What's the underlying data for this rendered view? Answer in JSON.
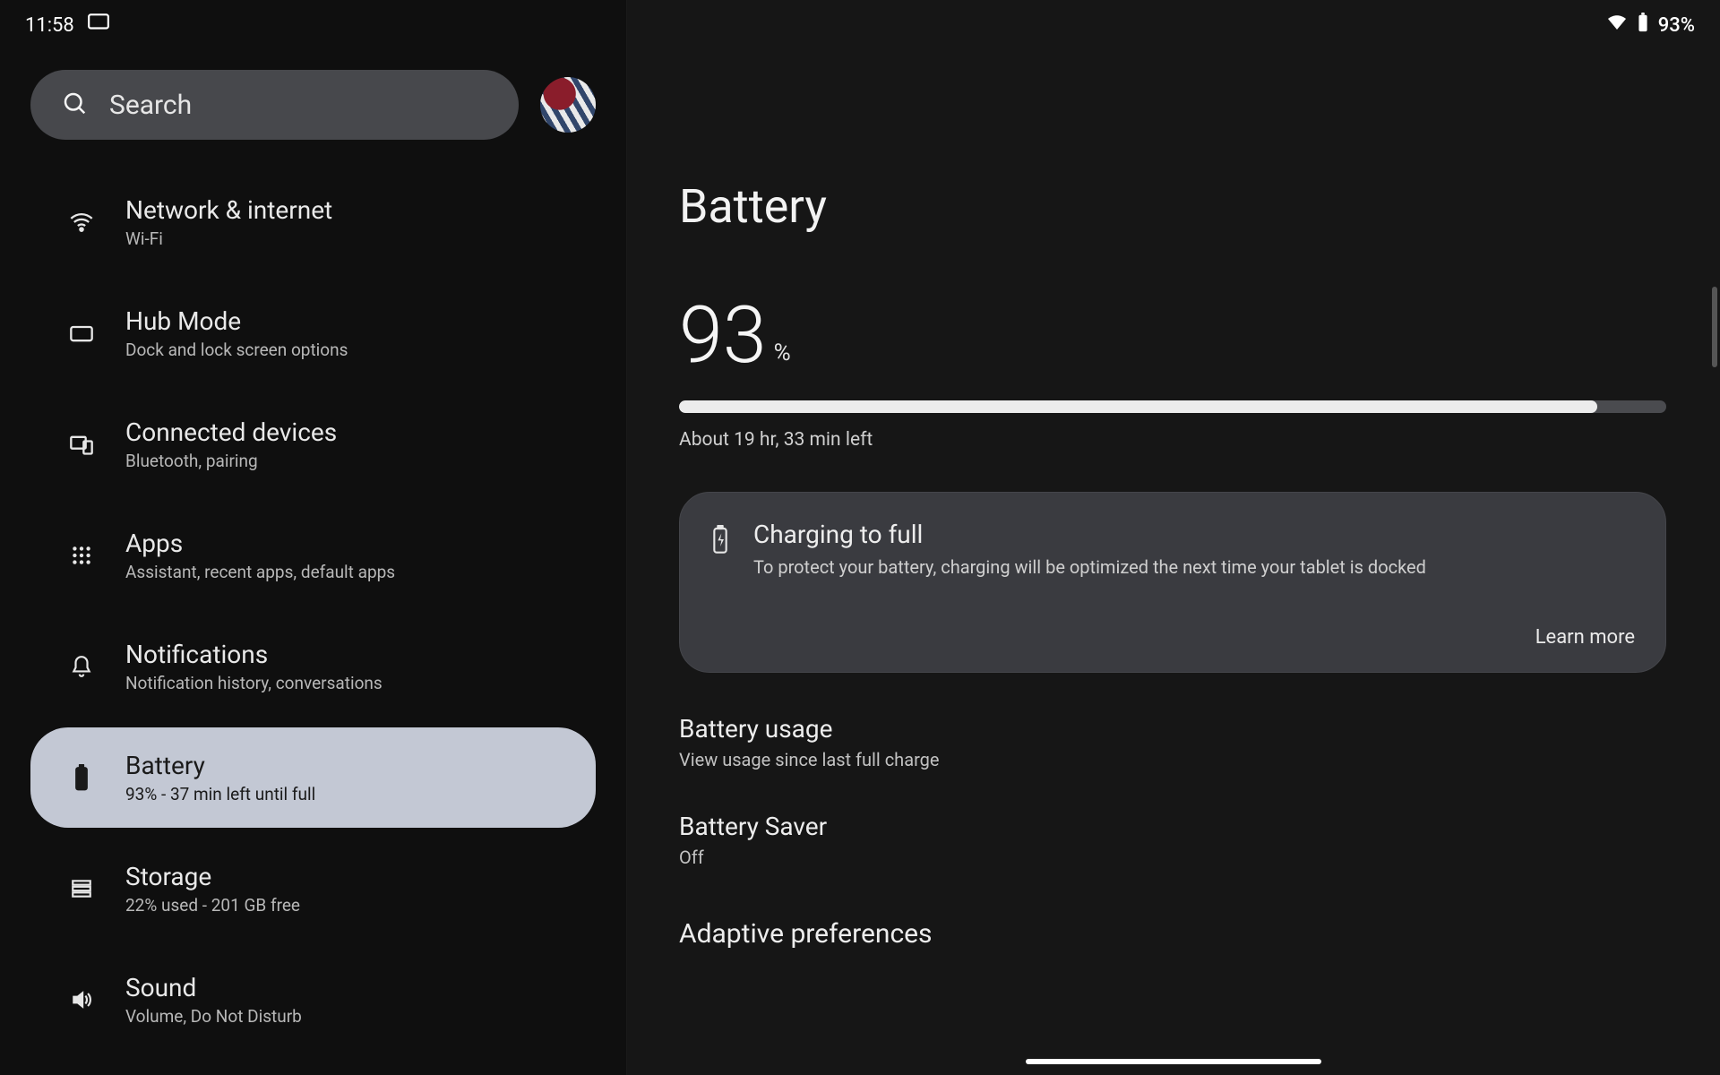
{
  "status": {
    "time": "11:58",
    "battery_text": "93%"
  },
  "search": {
    "placeholder": "Search"
  },
  "sidebar": {
    "items": [
      {
        "title": "Network & internet",
        "sub": "Wi-Fi"
      },
      {
        "title": "Hub Mode",
        "sub": "Dock and lock screen options"
      },
      {
        "title": "Connected devices",
        "sub": "Bluetooth, pairing"
      },
      {
        "title": "Apps",
        "sub": "Assistant, recent apps, default apps"
      },
      {
        "title": "Notifications",
        "sub": "Notification history, conversations"
      },
      {
        "title": "Battery",
        "sub": "93% - 37 min left until full"
      },
      {
        "title": "Storage",
        "sub": "22% used - 201 GB free"
      },
      {
        "title": "Sound",
        "sub": "Volume, Do Not Disturb"
      }
    ],
    "selected_index": 5
  },
  "battery": {
    "page_title": "Battery",
    "percent_value": "93",
    "percent_unit": "%",
    "percent_number": 93,
    "estimate": "About 19 hr, 33 min left",
    "card": {
      "title": "Charging to full",
      "sub": "To protect your battery, charging will be optimized the next time your tablet is docked",
      "link": "Learn more"
    },
    "usage": {
      "title": "Battery usage",
      "sub": "View usage since last full charge"
    },
    "saver": {
      "title": "Battery Saver",
      "sub": "Off"
    },
    "section_adaptive": "Adaptive preferences"
  }
}
